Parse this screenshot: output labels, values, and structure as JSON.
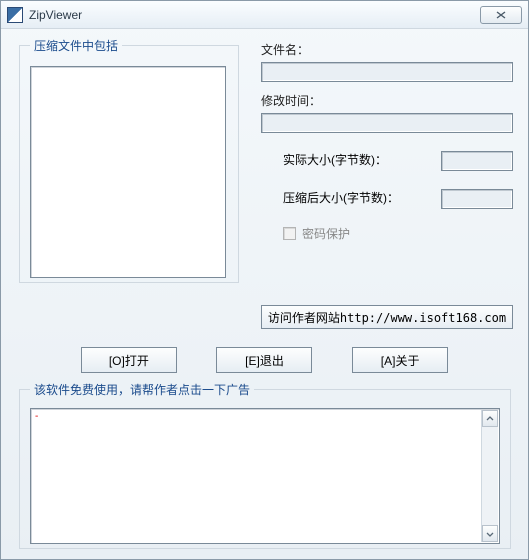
{
  "window": {
    "title": "ZipViewer"
  },
  "group_list": {
    "legend": "压缩文件中包括"
  },
  "right": {
    "filename_label": "文件名：",
    "filename_value": "",
    "modtime_label": "修改时间：",
    "modtime_value": "",
    "realsize_label": "实际大小(字节数)：",
    "realsize_value": "",
    "compsize_label": "压缩后大小(字节数)：",
    "compsize_value": "",
    "password_label": "密码保护",
    "password_checked": false
  },
  "link_button": "访问作者网站http://www.isoft168.com",
  "buttons": {
    "open": "[O]打开",
    "exit": "[E]退出",
    "about": "[A]关于"
  },
  "group_ad": {
    "legend": "该软件免费使用，请帮作者点击一下广告"
  }
}
